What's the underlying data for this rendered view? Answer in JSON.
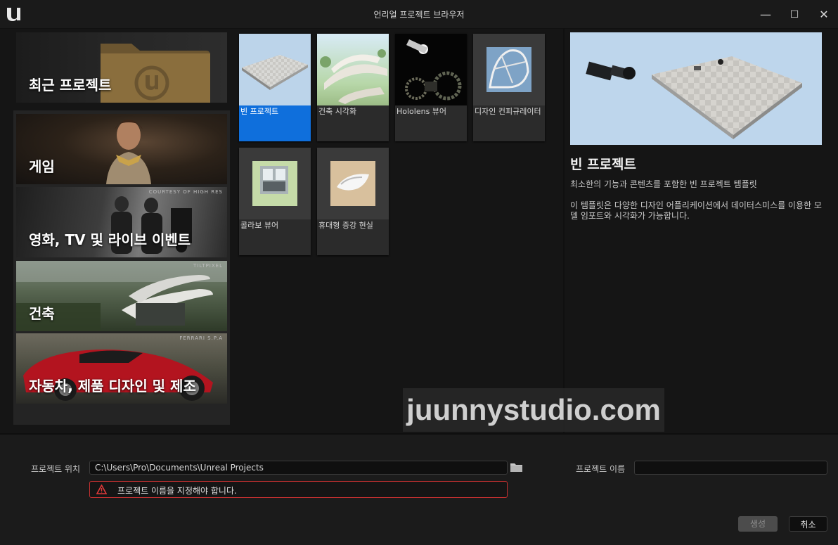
{
  "window": {
    "title": "언리얼 프로젝트 브라우저",
    "minimize": "—",
    "maximize": "☐",
    "close": "✕"
  },
  "recent": {
    "label": "최근 프로젝트"
  },
  "categories": [
    {
      "label": "게임",
      "credit": ""
    },
    {
      "label": "영화, TV 및 라이브 이벤트",
      "credit": "COURTESY OF HIGH RES"
    },
    {
      "label": "건축",
      "credit": "TILTPIXEL"
    },
    {
      "label": "자동차, 제품 디자인 및 제조",
      "credit": "FERRARI S.P.A"
    }
  ],
  "templates": [
    {
      "label": "빈 프로젝트"
    },
    {
      "label": "건축 시각화"
    },
    {
      "label": "Hololens 뷰어"
    },
    {
      "label": "디자인 컨피규레이터"
    },
    {
      "label": "콜라보 뷰어"
    },
    {
      "label": "휴대형 증강 현실"
    }
  ],
  "preview": {
    "title": "빈 프로젝트",
    "desc1": "최소한의 기능과 콘텐츠를 포함한 빈 프로젝트 템플릿",
    "desc2": "이 템플릿은 다양한 디자인 어플리케이션에서 데이터스미스를 이용한 모델 임포트와 시각화가 가능합니다."
  },
  "form": {
    "location_label": "프로젝트 위치",
    "location_value": "C:\\Users\\Pro\\Documents\\Unreal Projects",
    "name_label": "프로젝트 이름",
    "name_value": "",
    "error": "프로젝트 이름을 지정해야 합니다.",
    "create": "생성",
    "cancel": "취소"
  },
  "watermark": "juunnystudio.com",
  "colors": {
    "selection": "#0f6fdc",
    "error_border": "#c53030",
    "background": "#151515"
  }
}
